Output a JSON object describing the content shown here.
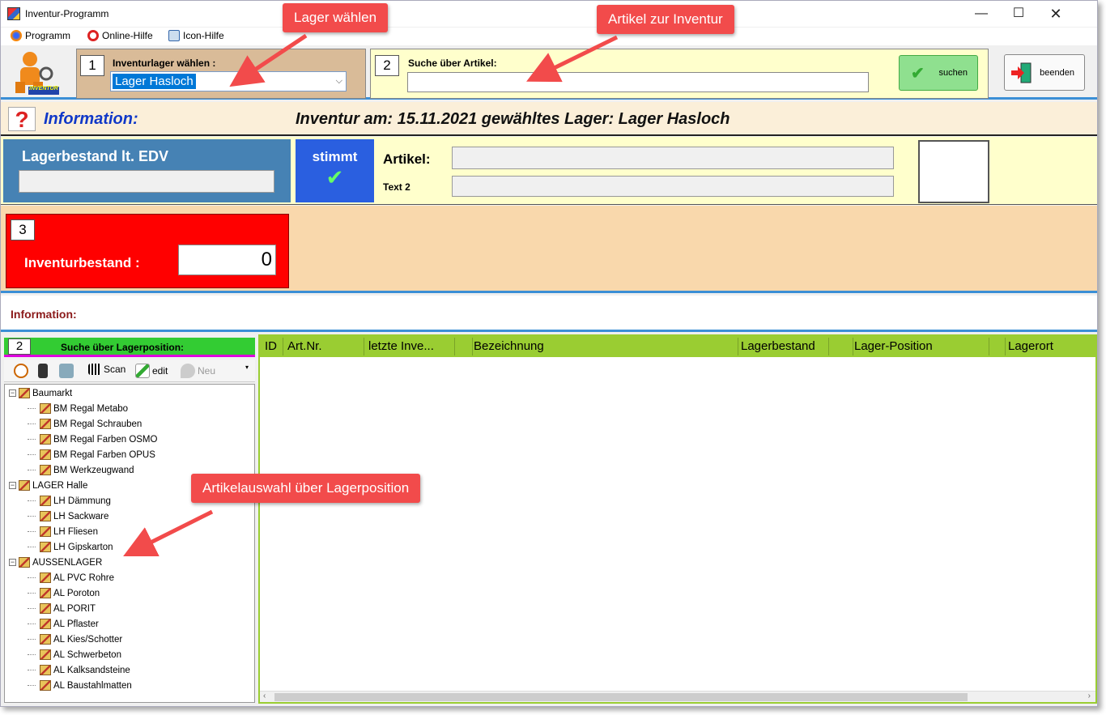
{
  "window": {
    "title": "Inventur-Programm",
    "controls": {
      "minimize": "—",
      "maximize": "☐",
      "close": "✕"
    }
  },
  "menu": {
    "items": [
      {
        "label": "Programm",
        "icon": "firefox-globe-icon"
      },
      {
        "label": "Online-Hilfe",
        "icon": "lifebuoy-icon"
      },
      {
        "label": "Icon-Hilfe",
        "icon": "help-doc-icon"
      }
    ]
  },
  "top": {
    "logo_text": "INVENTUR",
    "step1": {
      "number": "1",
      "label": "Inventurlager wählen :",
      "selected": "Lager Hasloch"
    },
    "step2": {
      "number": "2",
      "label": "Suche über  Artikel:",
      "value": "",
      "search_button": "suchen"
    },
    "exit_button": "beenden"
  },
  "info": {
    "label": "Information:",
    "text": "Inventur am: 15.11.2021  gewähltes Lager:  Lager Hasloch"
  },
  "stock": {
    "edv_label": "Lagerbestand lt. EDV",
    "edv_value": "",
    "stimmt_label": "stimmt",
    "article_label": "Artikel:",
    "article_value": "",
    "text2_label": "Text 2",
    "text2_value": ""
  },
  "inventory": {
    "number": "3",
    "label": "Inventurbestand :",
    "value": "0"
  },
  "info2": {
    "label": "Information:"
  },
  "leftpanel": {
    "number": "2",
    "title": "Suche über  Lagerposition:",
    "toolbar": {
      "scan": "Scan",
      "edit": "edit",
      "neu": "Neu"
    },
    "tree": [
      {
        "label": "Baumarkt",
        "children": [
          "BM Regal Metabo",
          "BM Regal Schrauben",
          "BM Regal Farben OSMO",
          "BM Regal Farben OPUS",
          "BM Werkzeugwand"
        ]
      },
      {
        "label": "LAGER Halle",
        "children": [
          "LH Dämmung",
          "LH Sackware",
          "LH Fliesen",
          "LH Gipskarton"
        ]
      },
      {
        "label": "AUSSENLAGER",
        "children": [
          "AL PVC Rohre",
          "AL Poroton",
          "AL PORIT",
          "AL Pflaster",
          "AL Kies/Schotter",
          "AL Schwerbeton",
          "AL Kalksandsteine",
          "AL Baustahlmatten"
        ]
      }
    ]
  },
  "grid": {
    "columns": [
      "ID",
      "Art.Nr.",
      "letzte  Inve...",
      "",
      "Bezeichnung",
      "Lagerbestand",
      "",
      "Lager-Position",
      "",
      "Lagerort"
    ]
  },
  "callouts": {
    "lager": "Lager wählen",
    "artikel": "Artikel zur Inventur",
    "auswahl": "Artikelauswahl über Lagerposition"
  },
  "colors": {
    "accent_blue": "#3b8fd6",
    "callout_red": "#f24b4b",
    "grid_green": "#9acd32",
    "inventory_red": "#ff0000"
  }
}
